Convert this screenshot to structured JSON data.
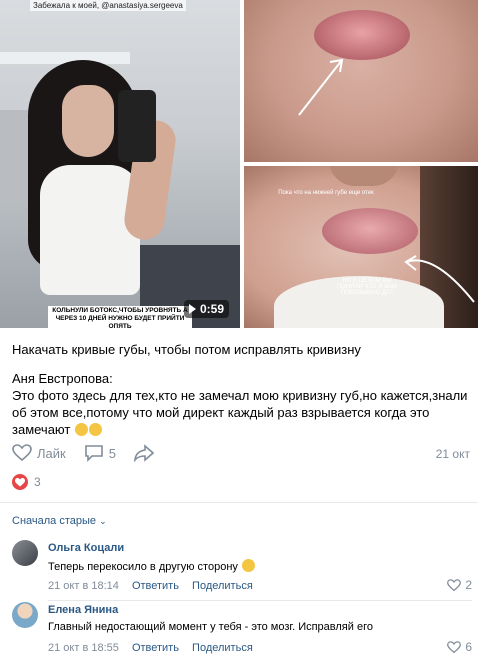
{
  "video": {
    "caption": "Забежала к моей, @anastasiya.sergeeva",
    "subtitle": "КОЛЬНУЛИ БОТОКС,ЧТОБЫ УРОВНЯТЬ А ЧЕРЕЗ 10 ДНЕЙ НУЖНО БУДЕТ ПРИЙТИ ОПЯТЬ",
    "duration": "0:59"
  },
  "photo": {
    "bottom_text_1": "Пока что на нижней губе еще отек",
    "bottom_text_2": "НО В ЦЕЛОМ ВЫ ПОНЯЛИ ЧТО Я ВАМ ПОКАЗЫВАЮ ДА?"
  },
  "post": {
    "caption": "Накачать кривые губы, чтобы потом исправлять кривизну",
    "author_line": "Аня Евстропова:",
    "body": "Это фото здесь для тех,кто не замечал мою кривизну губ,но кажется,знали об этом все,потому что мой директ каждый раз взрывается когда это замечают",
    "like_label": "Лайк",
    "comments_count": "5",
    "date": "21 окт",
    "reactions_count": "3"
  },
  "comments": {
    "sort_label": "Сначала старые",
    "items": [
      {
        "author": "Ольга Коцали",
        "text": "Теперь перекосило в другую сторону",
        "time": "21 окт в 18:14",
        "reply": "Ответить",
        "share": "Поделиться",
        "likes": "2"
      },
      {
        "author": "Елена Янина",
        "text": "Главный недостающий момент у тебя - это мозг. Исправляй его",
        "time": "21 окт в 18:55",
        "reply": "Ответить",
        "share": "Поделиться",
        "likes": "6"
      }
    ]
  },
  "colors": {
    "link": "#2a5885",
    "meta": "#818c99",
    "reaction": "#e64646"
  }
}
